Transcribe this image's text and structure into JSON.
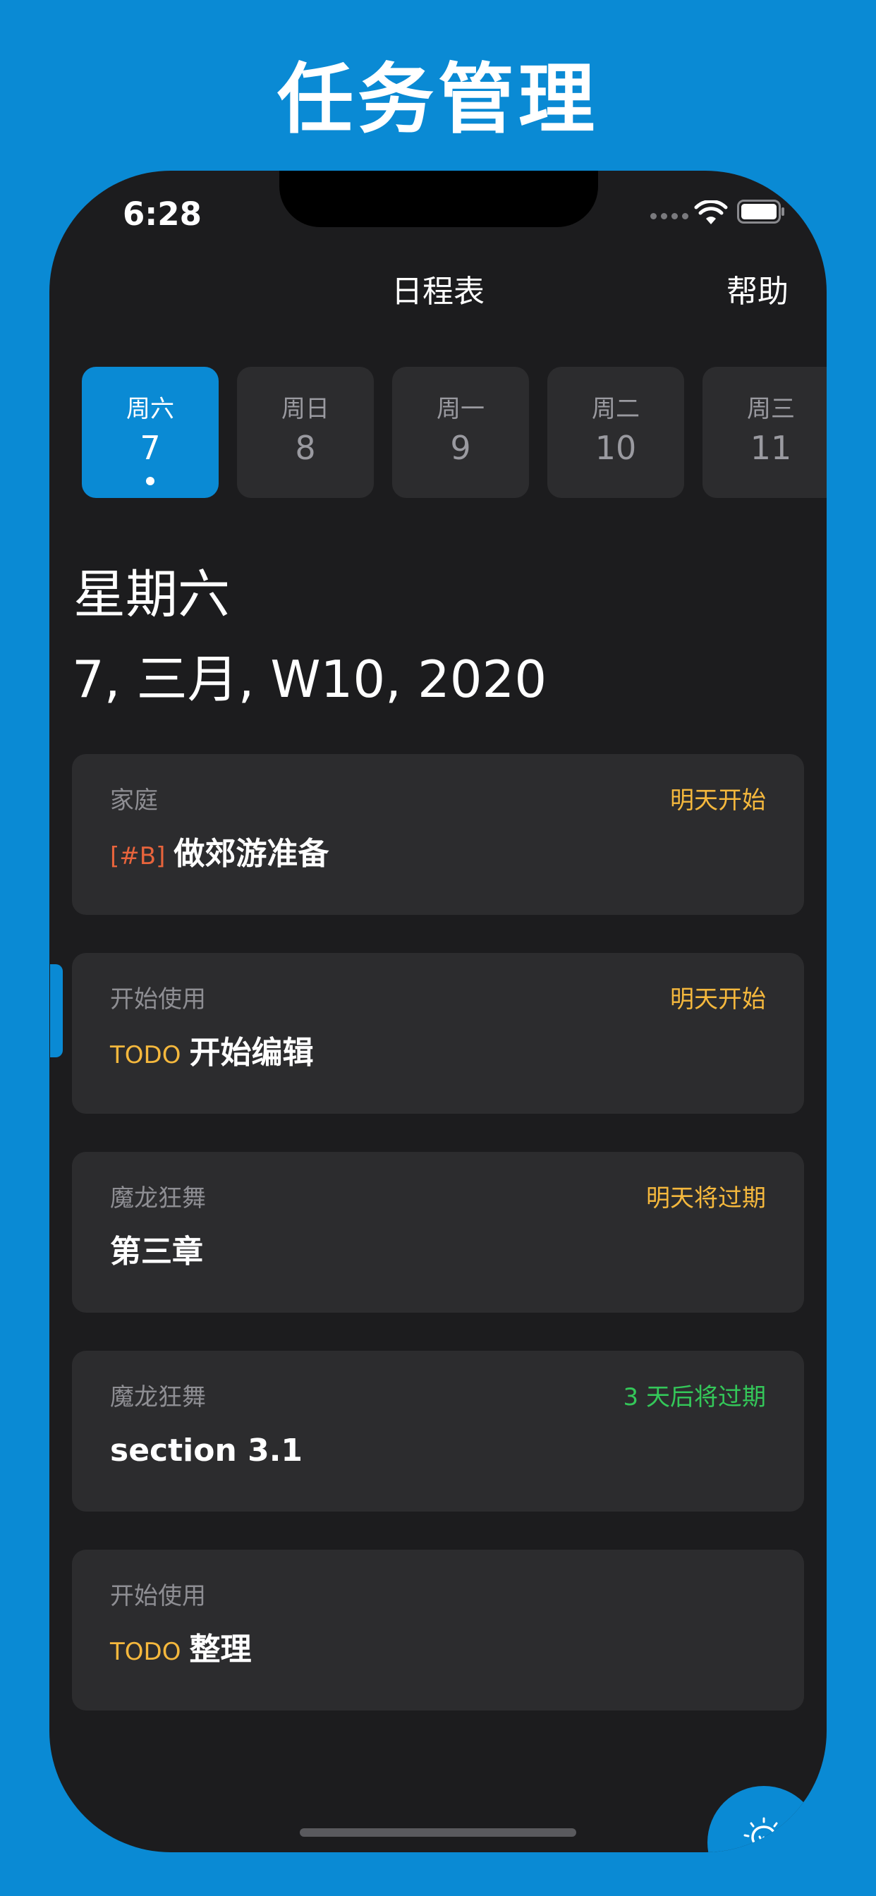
{
  "promo": {
    "title": "任务管理"
  },
  "status_bar": {
    "time": "6:28",
    "icons": [
      "cellular-dots-icon",
      "wifi-icon",
      "battery-icon"
    ]
  },
  "nav": {
    "title": "日程表",
    "help_label": "帮助"
  },
  "days": [
    {
      "dow": "周六",
      "num": "7",
      "selected": true,
      "has_items": true
    },
    {
      "dow": "周日",
      "num": "8",
      "selected": false
    },
    {
      "dow": "周一",
      "num": "9",
      "selected": false
    },
    {
      "dow": "周二",
      "num": "10",
      "selected": false
    },
    {
      "dow": "周三",
      "num": "11",
      "selected": false
    }
  ],
  "selected_date": {
    "weekday": "星期六",
    "full_date": "7, 三月, W10, 2020"
  },
  "tasks": [
    {
      "project": "家庭",
      "due": "明天开始",
      "due_color": "#F5B83D",
      "tag": "[#B]",
      "tag_color": "#E8643C",
      "title": "做郊游准备"
    },
    {
      "project": "开始使用",
      "due": "明天开始",
      "due_color": "#F5B83D",
      "tag": "TODO",
      "tag_color": "#F5B83D",
      "title": "开始编辑"
    },
    {
      "project": "魔龙狂舞",
      "due": "明天将过期",
      "due_color": "#F5B83D",
      "tag": "",
      "title": "第三章"
    },
    {
      "project": "魔龙狂舞",
      "due": "3 天后将过期",
      "due_color": "#34C759",
      "tag": "",
      "title": "section 3.1"
    },
    {
      "project": "开始使用",
      "due": "",
      "tag": "TODO",
      "tag_color": "#F5B83D",
      "title": "整理"
    }
  ],
  "fab": {
    "icon": "lightbulb-icon"
  },
  "colors": {
    "accent": "#0A8AD4",
    "background": "#1C1C1E",
    "card": "#2C2C2E",
    "due_soon": "#F5B83D",
    "due_later": "#34C759",
    "priority_tag": "#E8643C"
  }
}
